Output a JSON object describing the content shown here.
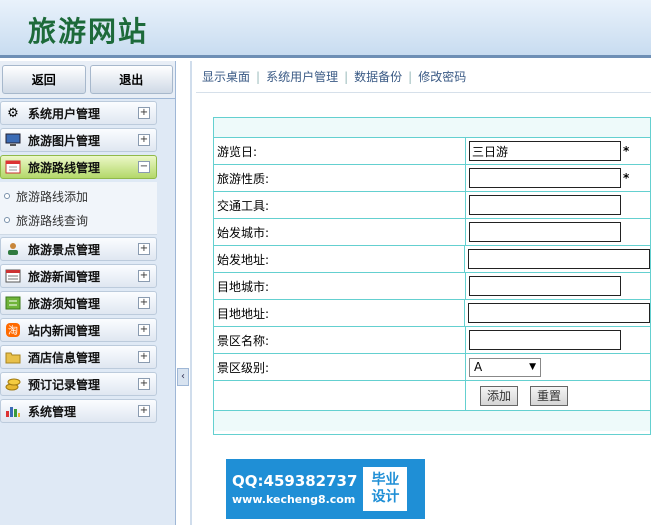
{
  "header": {
    "site_title": "旅游网站"
  },
  "sidebar": {
    "back_label": "返回",
    "logout_label": "退出",
    "items": [
      {
        "label": "系统用户管理",
        "icon": "gear-icon",
        "toggle": "+"
      },
      {
        "label": "旅游图片管理",
        "icon": "monitor-icon",
        "toggle": "+"
      },
      {
        "label": "旅游路线管理",
        "icon": "calendar-icon",
        "toggle": "−"
      },
      {
        "label": "旅游景点管理",
        "icon": "person-icon",
        "toggle": "+"
      },
      {
        "label": "旅游新闻管理",
        "icon": "news-icon",
        "toggle": "+"
      },
      {
        "label": "旅游须知管理",
        "icon": "notice-icon",
        "toggle": "+"
      },
      {
        "label": "站内新闻管理",
        "icon": "taobao-icon",
        "toggle": "+"
      },
      {
        "label": "酒店信息管理",
        "icon": "folder-icon",
        "toggle": "+"
      },
      {
        "label": "预订记录管理",
        "icon": "coins-icon",
        "toggle": "+"
      },
      {
        "label": "系统管理",
        "icon": "bar-chart-icon",
        "toggle": "+"
      }
    ],
    "submenu": [
      {
        "label": "旅游路线添加"
      },
      {
        "label": "旅游路线查询"
      }
    ]
  },
  "nav": {
    "items": [
      "显示桌面",
      "系统用户管理",
      "数据备份",
      "修改密码"
    ],
    "separator": "|"
  },
  "form": {
    "fields": [
      {
        "label": "游览日:",
        "value": "三日游",
        "required": "*"
      },
      {
        "label": "旅游性质:",
        "value": "",
        "required": "*"
      },
      {
        "label": "交通工具:",
        "value": ""
      },
      {
        "label": "始发城市:",
        "value": ""
      },
      {
        "label": "始发地址:",
        "value": ""
      },
      {
        "label": "目地城市:",
        "value": ""
      },
      {
        "label": "目地地址:",
        "value": ""
      },
      {
        "label": "景区名称:",
        "value": ""
      },
      {
        "label": "景区级别:",
        "value": "A"
      }
    ],
    "add_label": "添加",
    "reset_label": "重置"
  },
  "watermark": {
    "qq": "QQ:459382737",
    "url": "www.kecheng8.com",
    "box_line1": "毕业",
    "box_line2": "设计"
  }
}
